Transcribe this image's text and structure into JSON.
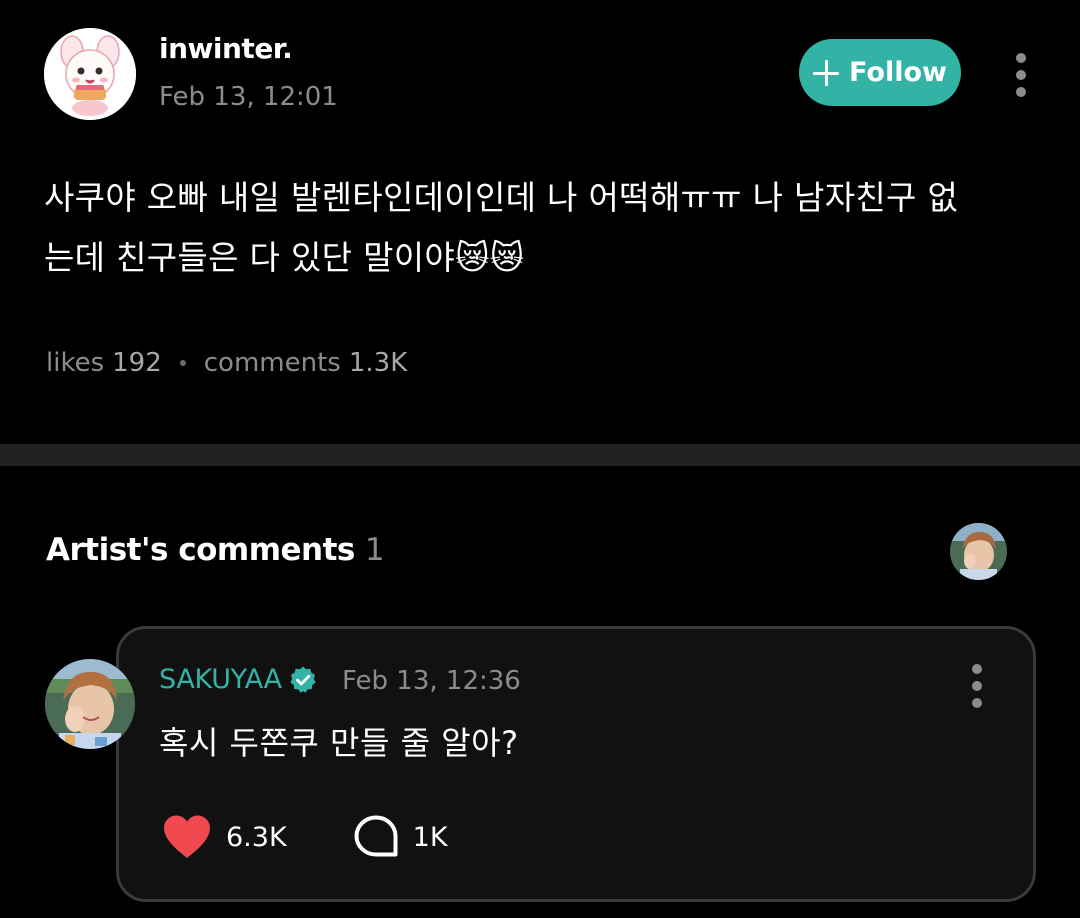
{
  "post": {
    "author_name": "inwinter.",
    "timestamp": "Feb 13, 12:01",
    "follow_label": "Follow",
    "body_line1": "사쿠야 오빠 내일 발렌타인데이인데 나 어떡해ㅠㅠ 나 남자친구 없",
    "body_line2": "는데 친구들은 다 있단 말이야😿😿",
    "likes_label": "likes",
    "likes_count": "192",
    "comments_label": "comments",
    "comments_count": "1.3K"
  },
  "artist_comments": {
    "title": "Artist's comments",
    "count": "1"
  },
  "comment": {
    "author_name": "SAKUYAA",
    "timestamp": "Feb 13, 12:36",
    "text": "혹시 두쫀쿠 만들 줄 알아?",
    "likes_count": "6.3K",
    "replies_count": "1K"
  },
  "colors": {
    "accent": "#33b3a6",
    "heart": "#f0494f",
    "muted_text": "#8c8c8c",
    "background": "#000000"
  },
  "icons": [
    "plus-icon",
    "more-vertical-icon",
    "verified-badge-icon",
    "heart-icon",
    "comment-bubble-icon"
  ]
}
